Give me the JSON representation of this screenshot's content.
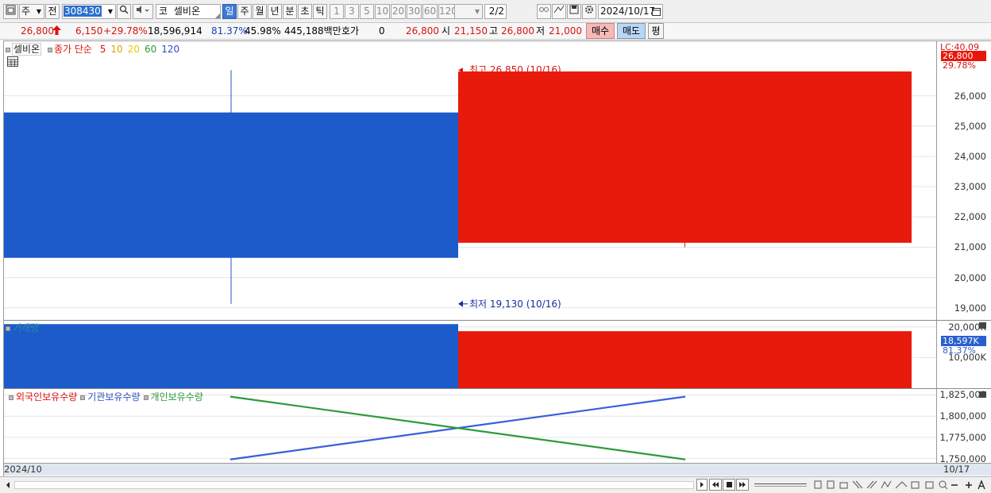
{
  "toolbar": {
    "period_type": "주",
    "prev_label": "전",
    "stock_code": "308430",
    "market_prefix": "코",
    "stock_name": "셀비온",
    "period_buttons": [
      "일",
      "주",
      "월",
      "년",
      "분",
      "초",
      "틱"
    ],
    "interval_buttons": [
      "1",
      "3",
      "5",
      "10",
      "20",
      "30",
      "60",
      "120"
    ],
    "page_indicator": "2/2",
    "date": "2024/10/17"
  },
  "quote": {
    "price": "26,800",
    "change": "6,150",
    "change_pct": "+29.78%",
    "volume": "18,596,914",
    "volume_ratio": "81.37%",
    "turnover": "45.98%",
    "amount": "445,188백만",
    "hoga_label": "호가",
    "hoga_value": "0",
    "hoga_price": "26,800",
    "open_label": "시",
    "open": "21,150",
    "high_label": "고",
    "high": "26,800",
    "low_label": "저",
    "low": "21,000",
    "buy_label": "매수",
    "sell_label": "매도",
    "eval_label": "평"
  },
  "price_panel": {
    "name": "셀비온",
    "ma_label": "종가 단순",
    "ma_periods": [
      {
        "label": "5",
        "color": "#d8140e"
      },
      {
        "label": "10",
        "color": "#e0a400"
      },
      {
        "label": "20",
        "color": "#e8c800"
      },
      {
        "label": "60",
        "color": "#2e9a3a"
      },
      {
        "label": "120",
        "color": "#2a4fc0"
      }
    ],
    "high_annot": "최고 26,850 (10/16)",
    "low_annot": "최저 19,130 (10/16)",
    "lc_label": "LC:40,09",
    "tag_price": "26,800",
    "tag_pct": "29.78%"
  },
  "volume_panel": {
    "title": "거래량",
    "tag_volume": "18,597K",
    "tag_pct": "81.37%"
  },
  "holdings_panel": {
    "series_labels": [
      {
        "label": "외국인보유수량",
        "color": "#d8140e"
      },
      {
        "label": "기관보유수량",
        "color": "#2a4fc0"
      },
      {
        "label": "개인보유수량",
        "color": "#2e9a3a"
      }
    ]
  },
  "footer": {
    "x_start": "2024/10",
    "x_end": "10/17"
  },
  "chart_data": [
    {
      "type": "candlestick",
      "title": "셀비온",
      "categories": [
        "10/16",
        "10/17"
      ],
      "series": [
        {
          "open": 25450,
          "high": 26850,
          "low": 19130,
          "close": 20650,
          "color": "#1c5bc9"
        },
        {
          "open": 21150,
          "high": 26800,
          "low": 21000,
          "close": 26800,
          "color": "#e81a0b"
        }
      ],
      "y_ticks": [
        "26,000",
        "25,000",
        "24,000",
        "23,000",
        "22,000",
        "21,000",
        "20,000",
        "19,000"
      ],
      "ylim": [
        18600,
        27800
      ],
      "grid": true
    },
    {
      "type": "bar",
      "title": "거래량",
      "categories": [
        "10/16",
        "10/17"
      ],
      "values": [
        20900000,
        18596914
      ],
      "colors": [
        "#1c5bc9",
        "#e81a0b"
      ],
      "y_ticks": [
        "20,000K",
        "10,000K"
      ],
      "ylim": [
        0,
        22000000
      ]
    },
    {
      "type": "line",
      "categories": [
        "10/16",
        "10/17"
      ],
      "series": [
        {
          "name": "기관보유수량",
          "color": "#3b5fd9",
          "values": [
            1749000,
            1823000
          ]
        },
        {
          "name": "개인보유수량",
          "color": "#2e9a3a",
          "values": [
            1823000,
            1749000
          ]
        }
      ],
      "y_ticks": [
        "1,825,000",
        "1,800,000",
        "1,775,000",
        "1,750,000"
      ],
      "ylim": [
        1745000,
        1832000
      ]
    }
  ]
}
